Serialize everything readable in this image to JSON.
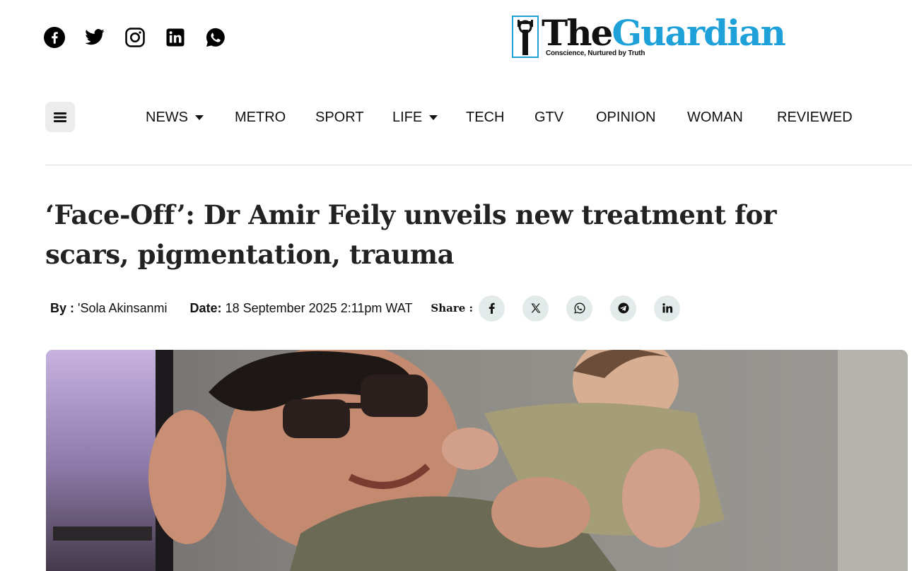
{
  "social": {
    "icons": [
      "facebook-icon",
      "twitter-icon",
      "instagram-icon",
      "linkedin-icon",
      "whatsapp-icon"
    ]
  },
  "logo": {
    "the": "The",
    "guardian": "Guardian",
    "tagline": "Conscience, Nurtured by Truth",
    "accent_color": "#1ea0d8"
  },
  "nav": {
    "items": [
      {
        "label": "NEWS",
        "dropdown": true
      },
      {
        "label": "METRO",
        "dropdown": false
      },
      {
        "label": "SPORT",
        "dropdown": false
      },
      {
        "label": "LIFE",
        "dropdown": true
      },
      {
        "label": "TECH",
        "dropdown": false
      },
      {
        "label": "GTV",
        "dropdown": false
      },
      {
        "label": "OPINION",
        "dropdown": false
      },
      {
        "label": "WOMAN",
        "dropdown": false
      },
      {
        "label": "REVIEWED",
        "dropdown": false
      }
    ]
  },
  "article": {
    "headline": "‘Face-Off’: Dr Amir Feily unveils new treatment for scars, pigmentation, trauma",
    "by_label": "By :",
    "author": "'Sola Akinsanmi",
    "date_label": "Date:",
    "date": "18 September 2025 2:11pm WAT",
    "share_label": "Share :",
    "share_icons": [
      "facebook-icon",
      "x-icon",
      "whatsapp-icon",
      "telegram-icon",
      "linkedin-icon"
    ],
    "share_bg_color": "#e3ebea"
  }
}
